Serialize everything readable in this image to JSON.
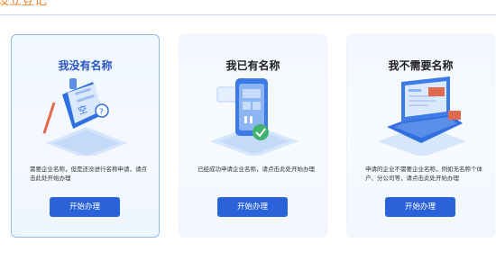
{
  "header": {
    "title": "设立登记"
  },
  "cards": [
    {
      "title": "我没有名称",
      "description": "需要企业名称，但是还没进行名称申请，请点击此处开始办理",
      "button": "开始办理",
      "selected": true,
      "illustration": "document-edit-illustration"
    },
    {
      "title": "我已有名称",
      "description": "已经成功申请企业名称，请点击此处开始办理",
      "button": "开始办理",
      "selected": false,
      "illustration": "phone-verified-illustration"
    },
    {
      "title": "我不需要名称",
      "description": "申请的企业不需要企业名称，例如无名称个体户、分公司等，请点击此处开始办理",
      "button": "开始办理",
      "selected": false,
      "illustration": "laptop-illustration"
    }
  ],
  "colors": {
    "accent": "#2a62d9",
    "header_title": "#e8842e",
    "selected_border": "#8fbbe8"
  }
}
